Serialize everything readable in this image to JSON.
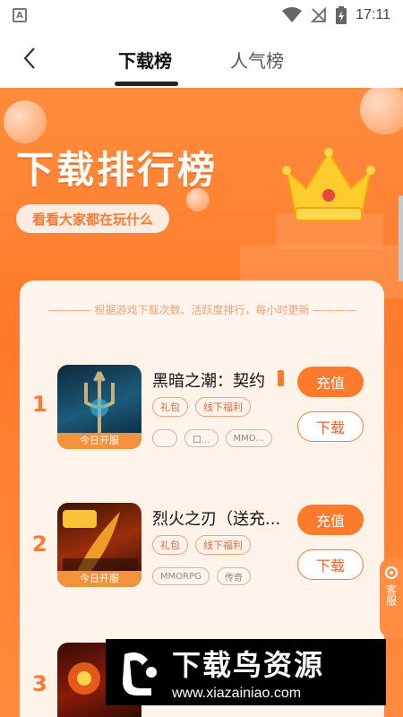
{
  "status_bar": {
    "time": "17:11"
  },
  "nav": {
    "tabs": [
      {
        "label": "下载榜"
      },
      {
        "label": "人气榜"
      }
    ]
  },
  "hero": {
    "title": "下载排行榜",
    "subtitle": "看看大家都在玩什么"
  },
  "list": {
    "note": "———— 根据游戏下载次数、活跃度排行，每小时更新 ————",
    "items": [
      {
        "rank": "1",
        "name": "黑暗之潮：契约",
        "open_label": "今日开服",
        "tags": [
          "礼包",
          "线下福利"
        ],
        "game_tags": [
          "",
          "口...",
          "MMO..."
        ],
        "recharge": "充值",
        "download": "下载"
      },
      {
        "rank": "2",
        "name": "烈火之刃（送充...",
        "open_label": "今日开服",
        "tags": [
          "礼包",
          "线下福利"
        ],
        "game_tags": [
          "MMORPG",
          "传奇"
        ],
        "recharge": "充值",
        "download": "下载"
      },
      {
        "rank": "3"
      }
    ]
  },
  "customer_service": {
    "label": "客服"
  },
  "watermark": {
    "title": "下载鸟资源",
    "url": "www.xiazainiao.com"
  }
}
